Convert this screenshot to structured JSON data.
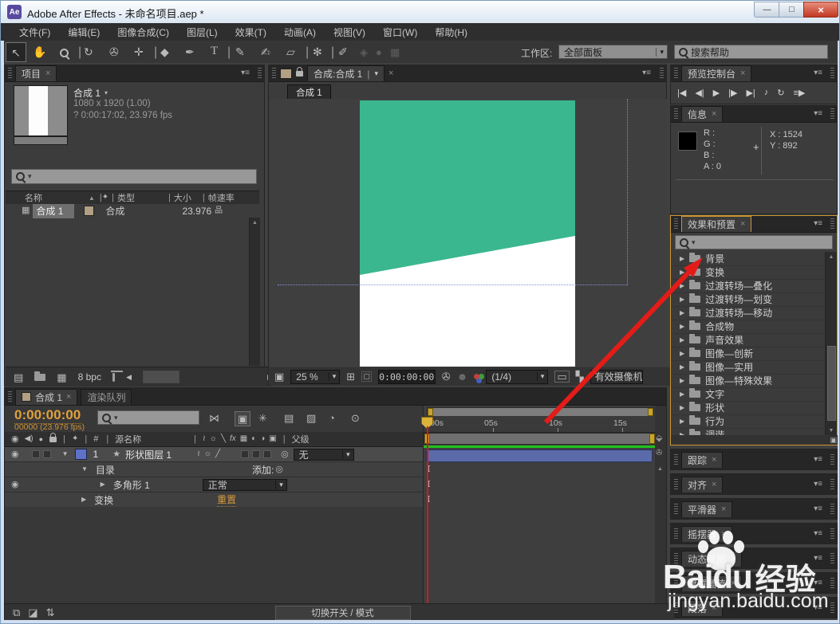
{
  "colors": {
    "focus_border_orange": "#c9982f",
    "canvas_green": "#3ab78f",
    "layer_bar_blue": "#5b6aa8",
    "timecode_orange": "#e0a13c",
    "ram_preview_green": "#1dc21d",
    "arrow_red": "#e31c18",
    "tan_swatch": "#b2a084",
    "layer_swatch_blue": "#5e72c8"
  },
  "icons": {
    "caret_down": "▼",
    "caret_down_small": "▾",
    "caret_right": "▶",
    "close": "×",
    "panel_menu": "▾≡",
    "eye": "◉",
    "speaker": "◀)",
    "solo": "●",
    "star": "★",
    "spiral": "◎",
    "sort_up": "▲",
    "tag": "✦",
    "hash": "#",
    "scroll_up": "▲",
    "scroll_down": "▼",
    "scroll_left": "◀",
    "scroll_right": "▶",
    "net": "品",
    "slate": "▤",
    "comp_grid": "▦",
    "pentagon_marker": "⬙",
    "camera_small": "✇",
    "grid": "▣",
    "safe": "⊞",
    "roi": "▢",
    "snapshot": "✇",
    "show_snapshot": "☻",
    "checker": "▚",
    "mini_view": "▭",
    "layers_icon": "⧉",
    "half_icon": "◪",
    "updown_icon": "⇅"
  },
  "window": {
    "title": "Adobe After Effects - 未命名项目.aep *",
    "app_icon": "Ae",
    "minimize": "—",
    "maximize": "□",
    "close": "×"
  },
  "menu": {
    "items": [
      "文件(F)",
      "编辑(E)",
      "图像合成(C)",
      "图层(L)",
      "效果(T)",
      "动画(A)",
      "视图(V)",
      "窗口(W)",
      "帮助(H)"
    ]
  },
  "toolbar": {
    "workspace_label": "工作区:",
    "workspace_value": "全部面板",
    "help_search": "搜索帮助",
    "tools": [
      {
        "name": "selection-tool",
        "glyph": "↖"
      },
      {
        "name": "hand-tool",
        "glyph": "✋"
      },
      {
        "name": "zoom-tool",
        "glyph": ""
      },
      {
        "name": "rotation-tool",
        "glyph": "↻"
      },
      {
        "name": "camera-tool",
        "glyph": "✇"
      },
      {
        "name": "pan-behind-tool",
        "glyph": "✛"
      },
      {
        "name": "shape-tool",
        "glyph": "◆"
      },
      {
        "name": "pen-tool",
        "glyph": "✒"
      },
      {
        "name": "text-tool",
        "glyph": "T"
      },
      {
        "name": "brush-tool",
        "glyph": "✎"
      },
      {
        "name": "clone-stamp-tool",
        "glyph": "✍"
      },
      {
        "name": "eraser-tool",
        "glyph": "▱"
      },
      {
        "name": "puppet-tool",
        "glyph": "✻"
      },
      {
        "name": "pin-tool",
        "glyph": "✐"
      }
    ],
    "disabled": [
      "◈",
      "●",
      "▦"
    ]
  },
  "project": {
    "tab": "项目",
    "info": {
      "name": "合成 1",
      "dims": "1080 x 1920 (1.00)",
      "meta": "? 0:00:17:02, 23.976 fps"
    },
    "cols": {
      "name": "名称",
      "type": "类型",
      "size": "大小",
      "fps": "帧速率"
    },
    "row": {
      "name": "合成 1",
      "type": "合成",
      "fps": "23.976"
    },
    "bit_depth": "8 bpc"
  },
  "comp": {
    "tab": "合成:合成 1",
    "nav_button": "合成 1",
    "zoom_value": "25 %",
    "timecode": "0:00:00:00",
    "resolution": "(1/4)",
    "view_name": "有效摄像机"
  },
  "preview": {
    "tab": "预览控制台",
    "buttons": [
      {
        "name": "first-frame-button",
        "glyph": "|◀"
      },
      {
        "name": "prev-frame-button",
        "glyph": "◀|"
      },
      {
        "name": "play-button",
        "glyph": "▶"
      },
      {
        "name": "next-frame-button",
        "glyph": "|▶"
      },
      {
        "name": "last-frame-button",
        "glyph": "▶|"
      },
      {
        "name": "audio-button",
        "glyph": "♪"
      },
      {
        "name": "loop-button",
        "glyph": "↻"
      },
      {
        "name": "ram-preview-button",
        "glyph": "≡▶"
      }
    ]
  },
  "info_panel": {
    "tab": "信息",
    "r": "R :",
    "g": "G :",
    "b": "B :",
    "a": "A : 0",
    "x": "X : 1524",
    "y": "Y : 892"
  },
  "effects": {
    "tab": "效果和预置",
    "items": [
      "背景",
      "变换",
      "过渡转场—叠化",
      "过渡转场—划变",
      "过渡转场—移动",
      "合成物",
      "声音效果",
      "图像—创新",
      "图像—实用",
      "图像—特殊效果",
      "文字",
      "形状",
      "行为",
      "调谐"
    ]
  },
  "side_panels": {
    "items": [
      "跟踪",
      "对齐",
      "平滑器",
      "摇摆器",
      "动态草图",
      "遮罩插值",
      "段落"
    ]
  },
  "timeline": {
    "tab_comp": "合成 1",
    "tab_render": "渲染队列",
    "timecode": "0:00:00:00",
    "frame_info": "00000 (23.976 fps)",
    "source_col": "源名称",
    "parent_col": "父级",
    "switch_icons": [
      "≀",
      "☼",
      "╲",
      "fx",
      "▦",
      "◐",
      "◑",
      "▣"
    ],
    "layer_switch_icons": [
      "≀",
      "☼",
      "╱"
    ],
    "view_icons": [
      "⋈",
      "▣",
      "✳",
      "▤",
      "▨",
      "◔",
      "⊙"
    ],
    "layer": {
      "index": "1",
      "name": "形状图层 1",
      "parent_value": "无"
    },
    "props": {
      "contents": "目录",
      "add_label": "添加:",
      "shape": "多角形 1",
      "blend_mode": "正常",
      "transform": "变换",
      "reset": "重置"
    },
    "ticks": [
      "00s",
      "05s",
      "10s",
      "15s"
    ],
    "mode_button": "切换开关 / 模式"
  },
  "watermark": {
    "brand": "Baidu",
    "brand_suffix": "经验",
    "url": "jingyan.baidu.com"
  }
}
